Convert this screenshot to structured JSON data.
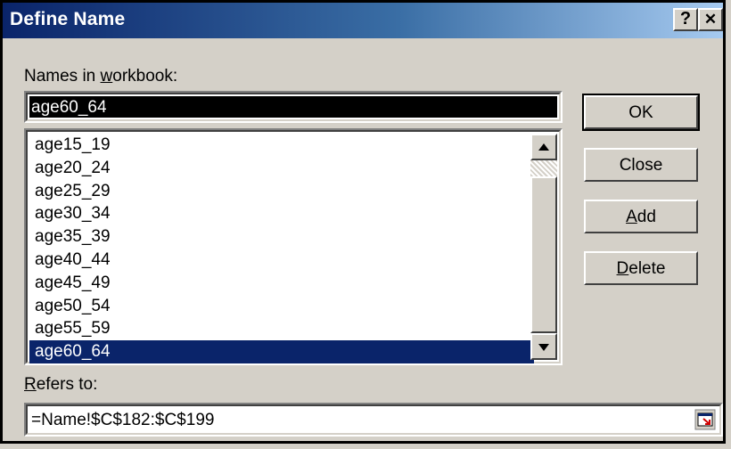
{
  "window": {
    "title": "Define Name",
    "help_label": "?",
    "close_label": "✕"
  },
  "names_label": {
    "prefix": "Names in ",
    "accel": "w",
    "suffix": "orkbook:"
  },
  "name_input": {
    "value": "age60_64"
  },
  "names_list": {
    "items": [
      "age15_19",
      "age20_24",
      "age25_29",
      "age30_34",
      "age35_39",
      "age40_44",
      "age45_49",
      "age50_54",
      "age55_59",
      "age60_64"
    ],
    "selected": "age60_64"
  },
  "buttons": {
    "ok": "OK",
    "close": "Close",
    "add": {
      "accel": "A",
      "rest": "dd"
    },
    "delete": {
      "accel": "D",
      "rest": "elete"
    }
  },
  "refers_label": {
    "accel": "R",
    "rest": "efers to:"
  },
  "refers_input": {
    "value": "=Name!$C$182:$C$199"
  },
  "colors": {
    "dialog_bg": "#d4d0c8",
    "titlebar_start": "#0a246a",
    "titlebar_end": "#a6caf0",
    "selection": "#0a246a"
  }
}
